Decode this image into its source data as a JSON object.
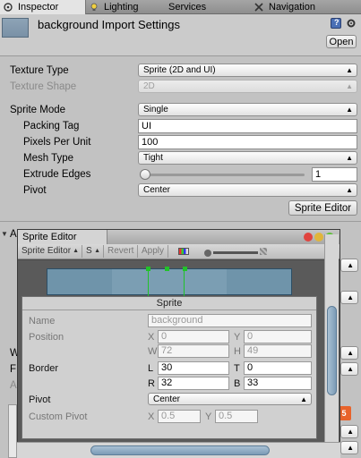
{
  "tabs": [
    {
      "label": "Inspector",
      "active": true
    },
    {
      "label": "Lighting"
    },
    {
      "label": "Services"
    },
    {
      "label": "Navigation"
    }
  ],
  "header": {
    "title": "background Import Settings",
    "open_label": "Open"
  },
  "props": {
    "texture_type": {
      "label": "Texture Type",
      "value": "Sprite (2D and UI)"
    },
    "texture_shape": {
      "label": "Texture Shape",
      "value": "2D"
    },
    "sprite_mode": {
      "label": "Sprite Mode",
      "value": "Single"
    },
    "packing_tag": {
      "label": "Packing Tag",
      "value": "UI"
    },
    "pixels_per_unit": {
      "label": "Pixels Per Unit",
      "value": "100"
    },
    "mesh_type": {
      "label": "Mesh Type",
      "value": "Tight"
    },
    "extrude_edges": {
      "label": "Extrude Edges",
      "value": "1"
    },
    "pivot": {
      "label": "Pivot",
      "value": "Center"
    }
  },
  "sprite_editor_button": "Sprite Editor",
  "behind_labels": [
    "A",
    "W",
    "F",
    "A"
  ],
  "sprite_editor": {
    "window_title": "Sprite Editor",
    "toolbar": {
      "mode": "Sprite Editor",
      "s": "S",
      "revert": "Revert",
      "apply": "Apply"
    },
    "panel": {
      "title": "Sprite",
      "name_label": "Name",
      "name_value": "background",
      "position_label": "Position",
      "x_label": "X",
      "x_value": "0",
      "y_label": "Y",
      "y_value": "0",
      "w_label": "W",
      "w_value": "72",
      "h_label": "H",
      "h_value": "49",
      "border_label": "Border",
      "l_label": "L",
      "l_value": "30",
      "t_label": "T",
      "t_value": "0",
      "r_label": "R",
      "r_value": "32",
      "b_label": "B",
      "b_value": "33",
      "pivot_label": "Pivot",
      "pivot_value": "Center",
      "custom_pivot_label": "Custom Pivot",
      "cx_label": "X",
      "cx_value": "0.5",
      "cy_label": "Y",
      "cy_value": "0.5"
    }
  },
  "colors": {
    "traffic_close": "#e0443e",
    "traffic_min": "#e0b53a",
    "traffic_max": "#5fbf3a",
    "border_guide": "#22c22a"
  }
}
